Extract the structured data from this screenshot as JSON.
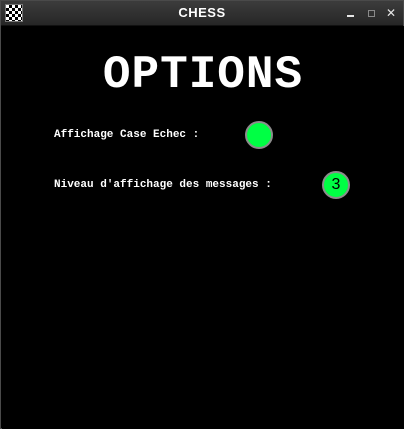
{
  "window": {
    "title": "CHESS",
    "controls": {
      "minimize": "",
      "maximize": "",
      "close": "✕"
    }
  },
  "options": {
    "heading": "OPTIONS",
    "check_square_display": {
      "label": "Affichage Case Echec :",
      "state": "on",
      "color": "#00ff44"
    },
    "message_level": {
      "label": "Niveau d'affichage des messages :",
      "value": "3",
      "color": "#00ff44"
    }
  }
}
